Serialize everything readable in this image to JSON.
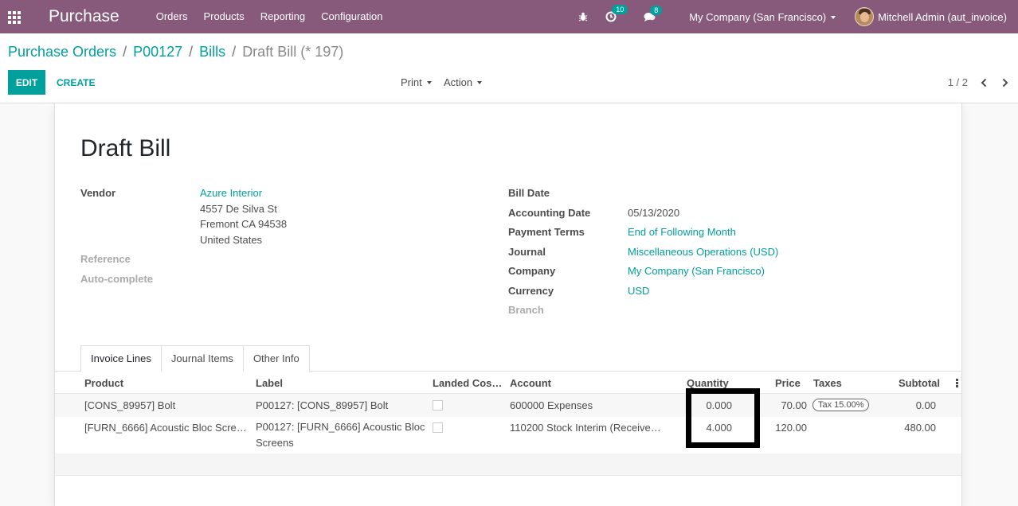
{
  "navbar": {
    "brand": "Purchase",
    "menu": [
      "Orders",
      "Products",
      "Reporting",
      "Configuration"
    ],
    "activity_count": "10",
    "message_count": "8",
    "company": "My Company (San Francisco)",
    "user": "Mitchell Admin (aut_invoice)"
  },
  "breadcrumb": {
    "items": [
      "Purchase Orders",
      "P00127",
      "Bills"
    ],
    "current": "Draft Bill (* 197)"
  },
  "toolbar": {
    "edit": "EDIT",
    "create": "CREATE",
    "print": "Print",
    "action": "Action",
    "pager": "1 / 2"
  },
  "form": {
    "title": "Draft Bill",
    "vendor_label": "Vendor",
    "vendor_name": "Azure Interior",
    "vendor_address": [
      "4557 De Silva St",
      "Fremont CA 94538",
      "United States"
    ],
    "reference_label": "Reference",
    "autocomplete_label": "Auto-complete",
    "bill_date_label": "Bill Date",
    "accounting_date_label": "Accounting Date",
    "accounting_date": "05/13/2020",
    "payment_terms_label": "Payment Terms",
    "payment_terms": "End of Following Month",
    "journal_label": "Journal",
    "journal": "Miscellaneous Operations (USD)",
    "company_label": "Company",
    "company": "My Company (San Francisco)",
    "currency_label": "Currency",
    "currency": "USD",
    "branch_label": "Branch"
  },
  "tabs": [
    "Invoice Lines",
    "Journal Items",
    "Other Info"
  ],
  "table": {
    "headers": {
      "product": "Product",
      "label": "Label",
      "landed": "Landed Cos…",
      "account": "Account",
      "quantity": "Quantity",
      "price": "Price",
      "taxes": "Taxes",
      "subtotal": "Subtotal"
    },
    "rows": [
      {
        "product": "[CONS_89957] Bolt",
        "label": "P00127: [CONS_89957] Bolt",
        "account": "600000 Expenses",
        "quantity": "0.000",
        "price": "70.00",
        "tax": "Tax 15.00%",
        "subtotal": "0.00"
      },
      {
        "product": "[FURN_6666] Acoustic Bloc Scree…",
        "label": "P00127: [FURN_6666] Acoustic Bloc Screens",
        "account": "110200 Stock Interim (Receive…",
        "quantity": "4.000",
        "price": "120.00",
        "tax": "",
        "subtotal": "480.00"
      }
    ]
  }
}
